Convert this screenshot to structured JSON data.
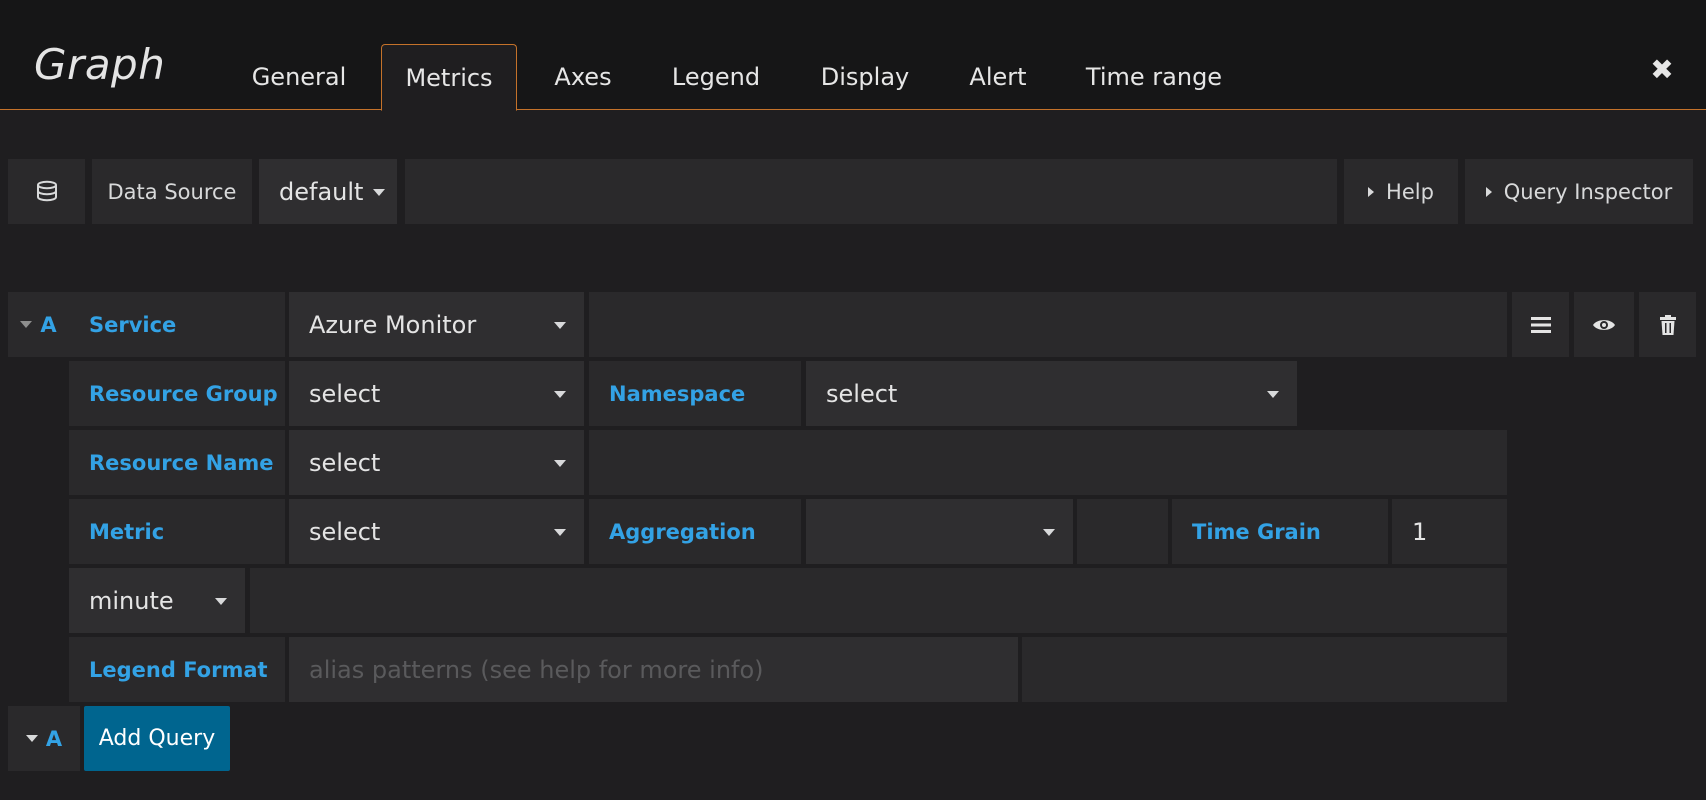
{
  "header": {
    "title": "Graph",
    "tabs": [
      "General",
      "Metrics",
      "Axes",
      "Legend",
      "Display",
      "Alert",
      "Time range"
    ],
    "active_tab": "Metrics"
  },
  "datasource_bar": {
    "label": "Data Source",
    "value": "default",
    "help": "Help",
    "query_inspector": "Query Inspector"
  },
  "query": {
    "ref_id": "A",
    "service_label": "Service",
    "service_value": "Azure Monitor",
    "resource_group_label": "Resource Group",
    "resource_group_value": "select",
    "namespace_label": "Namespace",
    "namespace_value": "select",
    "resource_name_label": "Resource Name",
    "resource_name_value": "select",
    "metric_label": "Metric",
    "metric_value": "select",
    "aggregation_label": "Aggregation",
    "aggregation_value": "",
    "time_grain_label": "Time Grain",
    "time_grain_value": "1",
    "time_grain_unit": "minute",
    "legend_format_label": "Legend Format",
    "legend_format_placeholder": "alias patterns (see help for more info)"
  },
  "footer": {
    "ref_id": "A",
    "add_query": "Add Query"
  },
  "colors": {
    "accent": "#c4722a",
    "label_blue": "#33a2e5",
    "primary_button": "#00658f"
  }
}
